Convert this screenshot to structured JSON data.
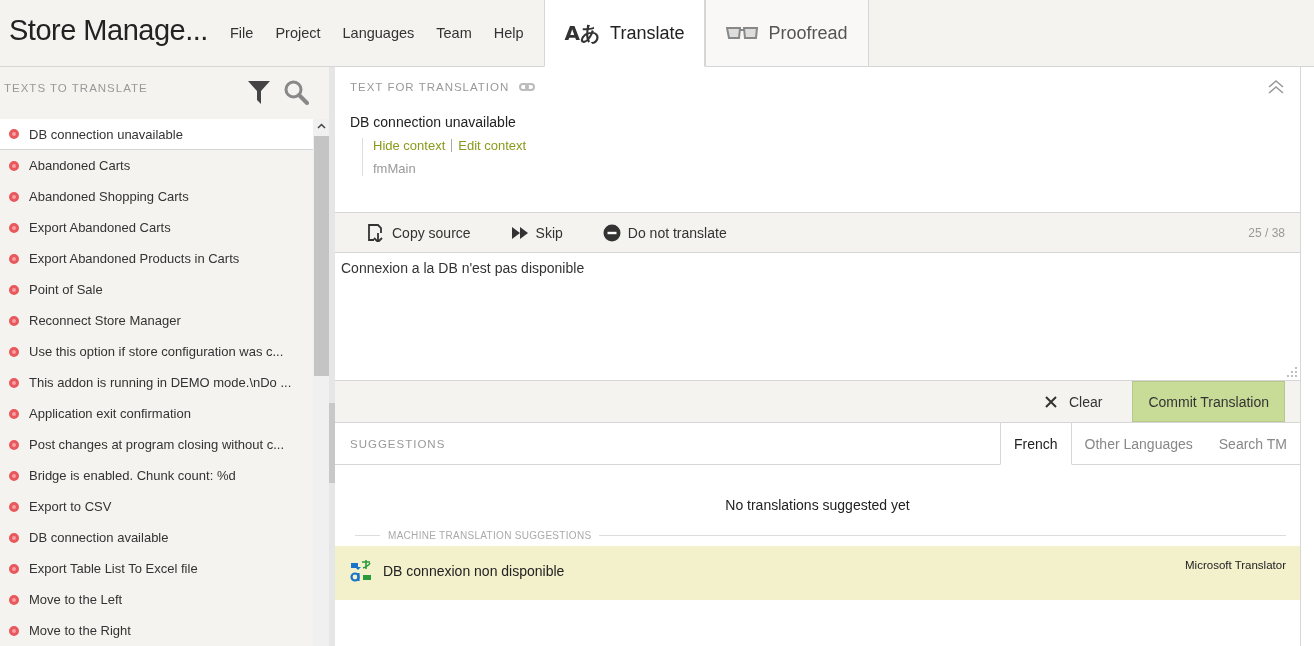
{
  "app_title": "Store Manage...",
  "menu": [
    "File",
    "Project",
    "Languages",
    "Team",
    "Help"
  ],
  "mode_tabs": [
    {
      "kind": "translate",
      "glyph": "Aあ",
      "label": "Translate",
      "selected": true
    },
    {
      "kind": "proofread",
      "label": "Proofread",
      "selected": false
    }
  ],
  "texts_panel": {
    "title": "TEXTS TO TRANSLATE",
    "items": [
      {
        "text": "DB connection unavailable",
        "selected": true,
        "color": "#e8585c"
      },
      {
        "text": "Abandoned Carts",
        "selected": false,
        "color": "#e8585c"
      },
      {
        "text": "Abandoned Shopping Carts",
        "selected": false,
        "color": "#e8585c"
      },
      {
        "text": "Export Abandoned Carts",
        "selected": false,
        "color": "#e8585c"
      },
      {
        "text": "Export Abandoned Products in Carts",
        "selected": false,
        "color": "#e8585c"
      },
      {
        "text": "Point of Sale",
        "selected": false,
        "color": "#e8585c"
      },
      {
        "text": "Reconnect Store Manager",
        "selected": false,
        "color": "#e8585c"
      },
      {
        "text": "Use this option if store configuration was c...",
        "selected": false,
        "color": "#e8585c"
      },
      {
        "text": "This addon is running in DEMO mode.\\nDo ...",
        "selected": false,
        "color": "#e8585c"
      },
      {
        "text": "Application exit confirmation",
        "selected": false,
        "color": "#e8585c"
      },
      {
        "text": "Post changes at program closing without c...",
        "selected": false,
        "color": "#e8585c"
      },
      {
        "text": "Bridge is enabled. Chunk count: %d",
        "selected": false,
        "color": "#e8585c"
      },
      {
        "text": "Export to CSV",
        "selected": false,
        "color": "#e8585c"
      },
      {
        "text": "DB connection available",
        "selected": false,
        "color": "#e8585c"
      },
      {
        "text": "Export Table List To Excel file",
        "selected": false,
        "color": "#e8585c"
      },
      {
        "text": "Move to the Left",
        "selected": false,
        "color": "#e8585c"
      },
      {
        "text": "Move to the Right",
        "selected": false,
        "color": "#e8585c"
      }
    ]
  },
  "source": {
    "title": "TEXT FOR TRANSLATION",
    "text": "DB connection unavailable",
    "links": [
      "Hide context",
      "Edit context"
    ],
    "context": "fmMain"
  },
  "toolbar": {
    "actions": [
      {
        "kind": "copy",
        "label": "Copy source"
      },
      {
        "kind": "skip",
        "label": "Skip"
      },
      {
        "kind": "ignore",
        "label": "Do not translate"
      }
    ],
    "counter": "25 / 38"
  },
  "translation": {
    "value": "Connexion a la DB n'est pas disponible"
  },
  "actions": {
    "clear": "Clear",
    "commit": "Commit Translation"
  },
  "suggestions": {
    "title": "SUGGESTIONS",
    "tabs": [
      {
        "label": "French",
        "selected": true
      },
      {
        "label": "Other Languages",
        "selected": false
      },
      {
        "label": "Search TM",
        "selected": false
      }
    ],
    "empty_message": "No translations suggested yet",
    "machine_title": "MACHINE TRANSLATION SUGGESTIONS",
    "machine": [
      {
        "text": "DB connexion non disponible",
        "provider": "Microsoft Translator"
      }
    ]
  }
}
